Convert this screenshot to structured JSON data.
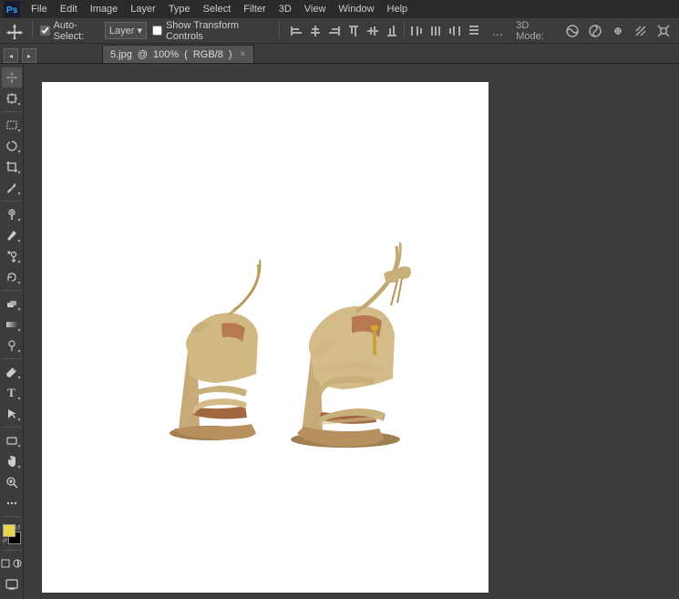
{
  "app": {
    "logo": "Ps",
    "title": "Adobe Photoshop"
  },
  "menubar": {
    "items": [
      "PS",
      "File",
      "Edit",
      "Image",
      "Layer",
      "Type",
      "Select",
      "Filter",
      "3D",
      "View",
      "Window",
      "Help"
    ]
  },
  "optionsbar": {
    "autoselect_label": "Auto-Select:",
    "autoselect_checked": true,
    "layer_dropdown": "Layer",
    "show_transform_label": "Show Transform Controls",
    "show_transform_checked": false,
    "more_label": "...",
    "mode_label": "3D Mode:",
    "align_icons": [
      "align-left",
      "align-center",
      "align-right",
      "align-top",
      "align-middle",
      "align-bottom",
      "distribute-left",
      "distribute-center",
      "distribute-right",
      "distribute-top"
    ],
    "mode_icons": [
      "rotate3d",
      "undo3d"
    ]
  },
  "tabbar": {
    "tabs": [
      {
        "name": "5.jpg @ 100% (RGB/8)",
        "active": true
      }
    ]
  },
  "tools": {
    "left_column": [
      {
        "id": "move",
        "icon": "✛",
        "active": true,
        "has_arrow": false
      },
      {
        "id": "artboard",
        "icon": "⊡",
        "active": false,
        "has_arrow": true
      },
      {
        "id": "select-rect",
        "icon": "⬜",
        "active": false,
        "has_arrow": true
      },
      {
        "id": "lasso",
        "icon": "⌒",
        "active": false,
        "has_arrow": true
      },
      {
        "id": "crop",
        "icon": "⊕",
        "active": false,
        "has_arrow": true
      },
      {
        "id": "eyedropper",
        "icon": "⊘",
        "active": false,
        "has_arrow": true
      },
      {
        "id": "healing",
        "icon": "✙",
        "active": false,
        "has_arrow": true
      },
      {
        "id": "brush",
        "icon": "⬧",
        "active": false,
        "has_arrow": true
      },
      {
        "id": "clone",
        "icon": "⊗",
        "active": false,
        "has_arrow": true
      },
      {
        "id": "history",
        "icon": "◎",
        "active": false,
        "has_arrow": true
      },
      {
        "id": "eraser",
        "icon": "◫",
        "active": false,
        "has_arrow": true
      },
      {
        "id": "gradient",
        "icon": "◱",
        "active": false,
        "has_arrow": true
      },
      {
        "id": "dodge",
        "icon": "◴",
        "active": false,
        "has_arrow": true
      },
      {
        "id": "pen",
        "icon": "✒",
        "active": false,
        "has_arrow": true
      },
      {
        "id": "type",
        "icon": "T",
        "active": false,
        "has_arrow": true
      },
      {
        "id": "path-select",
        "icon": "▸",
        "active": false,
        "has_arrow": true
      },
      {
        "id": "shape",
        "icon": "▭",
        "active": false,
        "has_arrow": true
      },
      {
        "id": "hand",
        "icon": "✋",
        "active": false,
        "has_arrow": true
      },
      {
        "id": "zoom",
        "icon": "⊕",
        "active": false,
        "has_arrow": false
      },
      {
        "id": "more",
        "icon": "…",
        "active": false,
        "has_arrow": false
      }
    ],
    "foreground_color": "#e8d44d",
    "background_color": "#000000",
    "bottom_icons": [
      "screen-mode",
      "quick-mask",
      "screen-view"
    ]
  },
  "canvas": {
    "filename": "5.jpg",
    "zoom": "100%",
    "colormode": "RGB/8",
    "bg_color": "#3c3c3c",
    "canvas_bg": "#ffffff"
  },
  "colors": {
    "app_bg": "#3c3c3c",
    "menubar_bg": "#2b2b2b",
    "toolbar_bg": "#3c3c3c",
    "tab_bg": "#535353",
    "accent": "#4a4a4a"
  }
}
